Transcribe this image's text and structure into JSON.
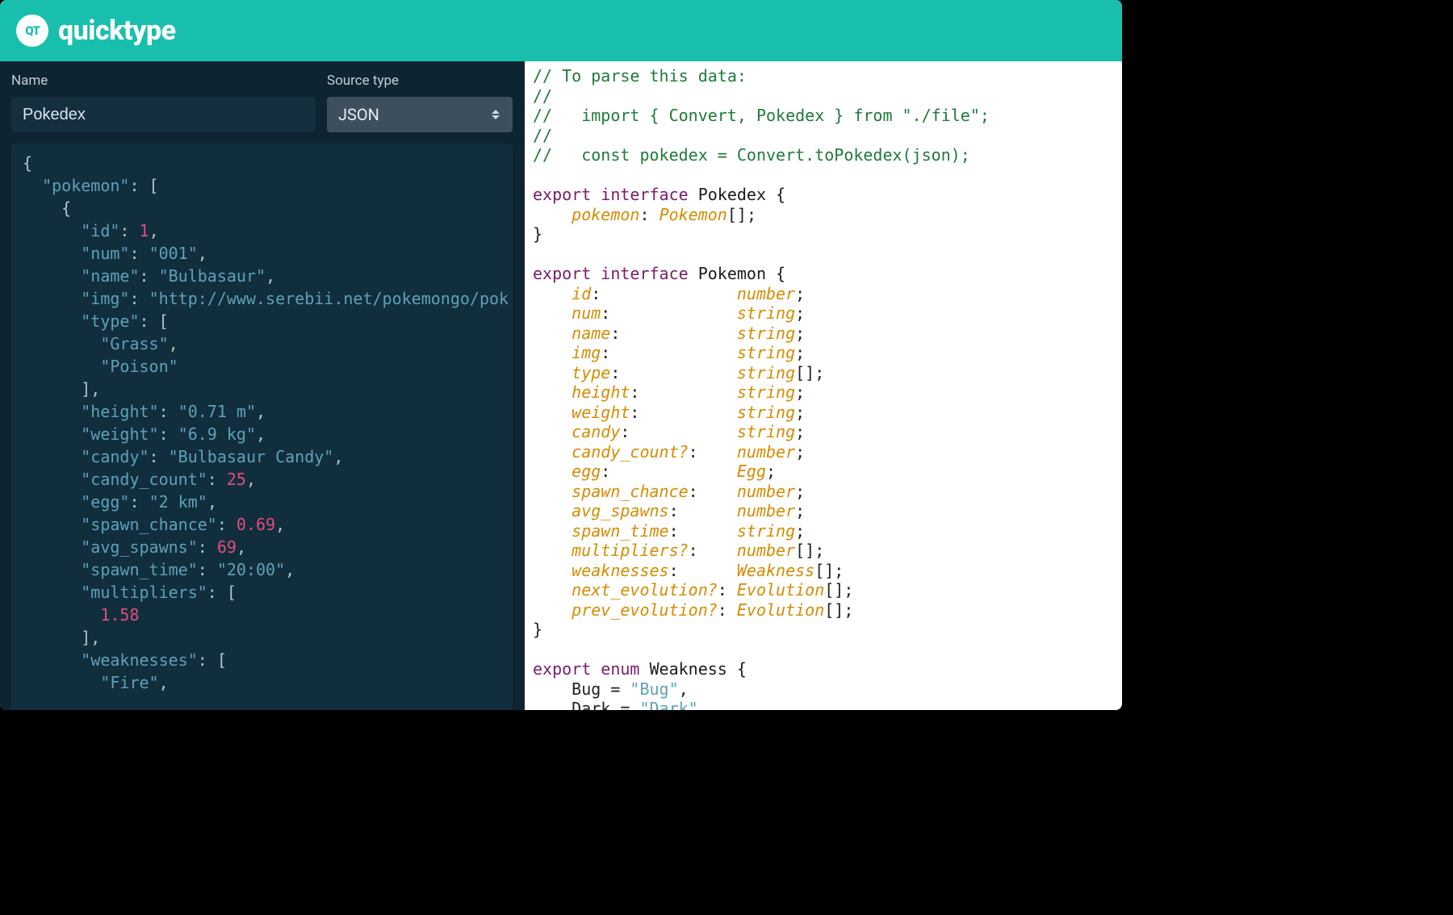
{
  "brand": {
    "badge": "QT",
    "name": "quicktype"
  },
  "controls": {
    "name_label": "Name",
    "name_value": "Pokedex",
    "source_label": "Source type",
    "source_value": "JSON"
  },
  "json_input": {
    "lines": [
      [
        [
          "p",
          "{"
        ]
      ],
      [
        [
          "p",
          "  "
        ],
        [
          "k",
          "\"pokemon\""
        ],
        [
          "p",
          ": ["
        ]
      ],
      [
        [
          "p",
          "    {"
        ]
      ],
      [
        [
          "p",
          "      "
        ],
        [
          "k",
          "\"id\""
        ],
        [
          "p",
          ": "
        ],
        [
          "n",
          "1"
        ],
        [
          "p",
          ","
        ]
      ],
      [
        [
          "p",
          "      "
        ],
        [
          "k",
          "\"num\""
        ],
        [
          "p",
          ": "
        ],
        [
          "sv",
          "\"001\""
        ],
        [
          "p",
          ","
        ]
      ],
      [
        [
          "p",
          "      "
        ],
        [
          "k",
          "\"name\""
        ],
        [
          "p",
          ": "
        ],
        [
          "sv",
          "\"Bulbasaur\""
        ],
        [
          "p",
          ","
        ]
      ],
      [
        [
          "p",
          "      "
        ],
        [
          "k",
          "\"img\""
        ],
        [
          "p",
          ": "
        ],
        [
          "sv",
          "\"http://www.serebii.net/pokemongo/pok"
        ]
      ],
      [
        [
          "p",
          "      "
        ],
        [
          "k",
          "\"type\""
        ],
        [
          "p",
          ": ["
        ]
      ],
      [
        [
          "p",
          "        "
        ],
        [
          "sv",
          "\"Grass\""
        ],
        [
          "p",
          ","
        ]
      ],
      [
        [
          "p",
          "        "
        ],
        [
          "sv",
          "\"Poison\""
        ]
      ],
      [
        [
          "p",
          "      ],"
        ]
      ],
      [
        [
          "p",
          "      "
        ],
        [
          "k",
          "\"height\""
        ],
        [
          "p",
          ": "
        ],
        [
          "sv",
          "\"0.71 m\""
        ],
        [
          "p",
          ","
        ]
      ],
      [
        [
          "p",
          "      "
        ],
        [
          "k",
          "\"weight\""
        ],
        [
          "p",
          ": "
        ],
        [
          "sv",
          "\"6.9 kg\""
        ],
        [
          "p",
          ","
        ]
      ],
      [
        [
          "p",
          "      "
        ],
        [
          "k",
          "\"candy\""
        ],
        [
          "p",
          ": "
        ],
        [
          "sv",
          "\"Bulbasaur Candy\""
        ],
        [
          "p",
          ","
        ]
      ],
      [
        [
          "p",
          "      "
        ],
        [
          "k",
          "\"candy_count\""
        ],
        [
          "p",
          ": "
        ],
        [
          "n",
          "25"
        ],
        [
          "p",
          ","
        ]
      ],
      [
        [
          "p",
          "      "
        ],
        [
          "k",
          "\"egg\""
        ],
        [
          "p",
          ": "
        ],
        [
          "sv",
          "\"2 km\""
        ],
        [
          "p",
          ","
        ]
      ],
      [
        [
          "p",
          "      "
        ],
        [
          "k",
          "\"spawn_chance\""
        ],
        [
          "p",
          ": "
        ],
        [
          "n",
          "0.69"
        ],
        [
          "p",
          ","
        ]
      ],
      [
        [
          "p",
          "      "
        ],
        [
          "k",
          "\"avg_spawns\""
        ],
        [
          "p",
          ": "
        ],
        [
          "n",
          "69"
        ],
        [
          "p",
          ","
        ]
      ],
      [
        [
          "p",
          "      "
        ],
        [
          "k",
          "\"spawn_time\""
        ],
        [
          "p",
          ": "
        ],
        [
          "sv",
          "\"20:00\""
        ],
        [
          "p",
          ","
        ]
      ],
      [
        [
          "p",
          "      "
        ],
        [
          "k",
          "\"multipliers\""
        ],
        [
          "p",
          ": ["
        ]
      ],
      [
        [
          "p",
          "        "
        ],
        [
          "n",
          "1.58"
        ]
      ],
      [
        [
          "p",
          "      ],"
        ]
      ],
      [
        [
          "p",
          "      "
        ],
        [
          "k",
          "\"weaknesses\""
        ],
        [
          "p",
          ": ["
        ]
      ],
      [
        [
          "p",
          "        "
        ],
        [
          "sv",
          "\"Fire\""
        ],
        [
          "p",
          ","
        ]
      ]
    ]
  },
  "output": {
    "lines": [
      [
        [
          "cm",
          "// To parse this data:"
        ]
      ],
      [
        [
          "cm",
          "//"
        ]
      ],
      [
        [
          "cm",
          "//   import { Convert, Pokedex } from \"./file\";"
        ]
      ],
      [
        [
          "cm",
          "//"
        ]
      ],
      [
        [
          "cm",
          "//   const pokedex = Convert.toPokedex(json);"
        ]
      ],
      [
        [
          "p",
          ""
        ]
      ],
      [
        [
          "kw",
          "export"
        ],
        [
          "p",
          " "
        ],
        [
          "kw",
          "interface"
        ],
        [
          "p",
          " "
        ],
        [
          "nm",
          "Pokedex {"
        ]
      ],
      [
        [
          "p",
          "    "
        ],
        [
          "fn",
          "pokemon"
        ],
        [
          "p",
          ": "
        ],
        [
          "ty",
          "Pokemon"
        ],
        [
          "p",
          "[];"
        ]
      ],
      [
        [
          "p",
          "}"
        ]
      ],
      [
        [
          "p",
          ""
        ]
      ],
      [
        [
          "kw",
          "export"
        ],
        [
          "p",
          " "
        ],
        [
          "kw",
          "interface"
        ],
        [
          "p",
          " "
        ],
        [
          "nm",
          "Pokemon {"
        ]
      ],
      [
        [
          "p",
          "    "
        ],
        [
          "fn",
          "id"
        ],
        [
          "p",
          ":              "
        ],
        [
          "ty",
          "number"
        ],
        [
          "p",
          ";"
        ]
      ],
      [
        [
          "p",
          "    "
        ],
        [
          "fn",
          "num"
        ],
        [
          "p",
          ":             "
        ],
        [
          "ty",
          "string"
        ],
        [
          "p",
          ";"
        ]
      ],
      [
        [
          "p",
          "    "
        ],
        [
          "fn",
          "name"
        ],
        [
          "p",
          ":            "
        ],
        [
          "ty",
          "string"
        ],
        [
          "p",
          ";"
        ]
      ],
      [
        [
          "p",
          "    "
        ],
        [
          "fn",
          "img"
        ],
        [
          "p",
          ":             "
        ],
        [
          "ty",
          "string"
        ],
        [
          "p",
          ";"
        ]
      ],
      [
        [
          "p",
          "    "
        ],
        [
          "fn",
          "type"
        ],
        [
          "p",
          ":            "
        ],
        [
          "ty",
          "string"
        ],
        [
          "p",
          "[];"
        ]
      ],
      [
        [
          "p",
          "    "
        ],
        [
          "fn",
          "height"
        ],
        [
          "p",
          ":          "
        ],
        [
          "ty",
          "string"
        ],
        [
          "p",
          ";"
        ]
      ],
      [
        [
          "p",
          "    "
        ],
        [
          "fn",
          "weight"
        ],
        [
          "p",
          ":          "
        ],
        [
          "ty",
          "string"
        ],
        [
          "p",
          ";"
        ]
      ],
      [
        [
          "p",
          "    "
        ],
        [
          "fn",
          "candy"
        ],
        [
          "p",
          ":           "
        ],
        [
          "ty",
          "string"
        ],
        [
          "p",
          ";"
        ]
      ],
      [
        [
          "p",
          "    "
        ],
        [
          "fn",
          "candy_count?"
        ],
        [
          "p",
          ":    "
        ],
        [
          "ty",
          "number"
        ],
        [
          "p",
          ";"
        ]
      ],
      [
        [
          "p",
          "    "
        ],
        [
          "fn",
          "egg"
        ],
        [
          "p",
          ":             "
        ],
        [
          "ty",
          "Egg"
        ],
        [
          "p",
          ";"
        ]
      ],
      [
        [
          "p",
          "    "
        ],
        [
          "fn",
          "spawn_chance"
        ],
        [
          "p",
          ":    "
        ],
        [
          "ty",
          "number"
        ],
        [
          "p",
          ";"
        ]
      ],
      [
        [
          "p",
          "    "
        ],
        [
          "fn",
          "avg_spawns"
        ],
        [
          "p",
          ":      "
        ],
        [
          "ty",
          "number"
        ],
        [
          "p",
          ";"
        ]
      ],
      [
        [
          "p",
          "    "
        ],
        [
          "fn",
          "spawn_time"
        ],
        [
          "p",
          ":      "
        ],
        [
          "ty",
          "string"
        ],
        [
          "p",
          ";"
        ]
      ],
      [
        [
          "p",
          "    "
        ],
        [
          "fn",
          "multipliers?"
        ],
        [
          "p",
          ":    "
        ],
        [
          "ty",
          "number"
        ],
        [
          "p",
          "[];"
        ]
      ],
      [
        [
          "p",
          "    "
        ],
        [
          "fn",
          "weaknesses"
        ],
        [
          "p",
          ":      "
        ],
        [
          "ty",
          "Weakness"
        ],
        [
          "p",
          "[];"
        ]
      ],
      [
        [
          "p",
          "    "
        ],
        [
          "fn",
          "next_evolution?"
        ],
        [
          "p",
          ": "
        ],
        [
          "ty",
          "Evolution"
        ],
        [
          "p",
          "[];"
        ]
      ],
      [
        [
          "p",
          "    "
        ],
        [
          "fn",
          "prev_evolution?"
        ],
        [
          "p",
          ": "
        ],
        [
          "ty",
          "Evolution"
        ],
        [
          "p",
          "[];"
        ]
      ],
      [
        [
          "p",
          "}"
        ]
      ],
      [
        [
          "p",
          ""
        ]
      ],
      [
        [
          "kw",
          "export"
        ],
        [
          "p",
          " "
        ],
        [
          "kw",
          "enum"
        ],
        [
          "p",
          " "
        ],
        [
          "nm",
          "Weakness {"
        ]
      ],
      [
        [
          "p",
          "    Bug = "
        ],
        [
          "sg",
          "\"Bug\""
        ],
        [
          "p",
          ","
        ]
      ],
      [
        [
          "p",
          "    Dark = "
        ],
        [
          "sg",
          "\"Dark\""
        ],
        [
          "p",
          ","
        ]
      ]
    ]
  }
}
